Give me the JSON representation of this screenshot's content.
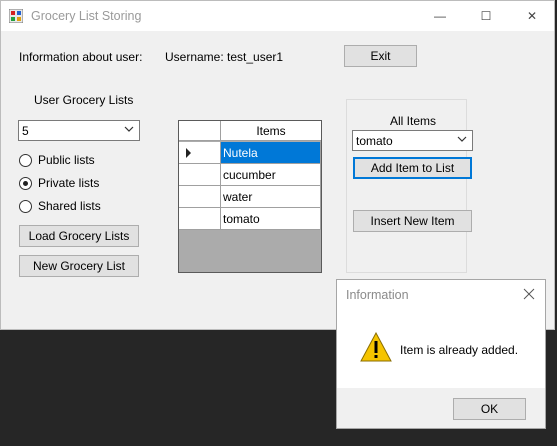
{
  "window": {
    "title": "Grocery List Storing",
    "min_glyph": "—",
    "max_glyph": "☐",
    "close_glyph": "✕"
  },
  "user": {
    "info_label": "Information about user:",
    "username_text": "Username: test_user1"
  },
  "exit_label": "Exit",
  "lists": {
    "heading": "User Grocery Lists",
    "combo_value": "5",
    "radios": [
      {
        "label": "Public lists",
        "checked": false
      },
      {
        "label": "Private lists",
        "checked": true
      },
      {
        "label": "Shared lists",
        "checked": false
      }
    ],
    "load_label": "Load Grocery Lists",
    "new_label": "New Grocery List"
  },
  "grid": {
    "column": "Items",
    "rows": [
      "Nutela",
      "cucumber",
      "water",
      "tomato"
    ],
    "selected_index": 0
  },
  "items_panel": {
    "heading": "All Items",
    "combo_value": "tomato",
    "add_label": "Add Item to List",
    "insert_label": "Insert New Item"
  },
  "dialog": {
    "title": "Information",
    "message": "Item is already added.",
    "ok_label": "OK"
  },
  "colors": {
    "accent": "#0078d7",
    "warning": "#f5c400"
  }
}
